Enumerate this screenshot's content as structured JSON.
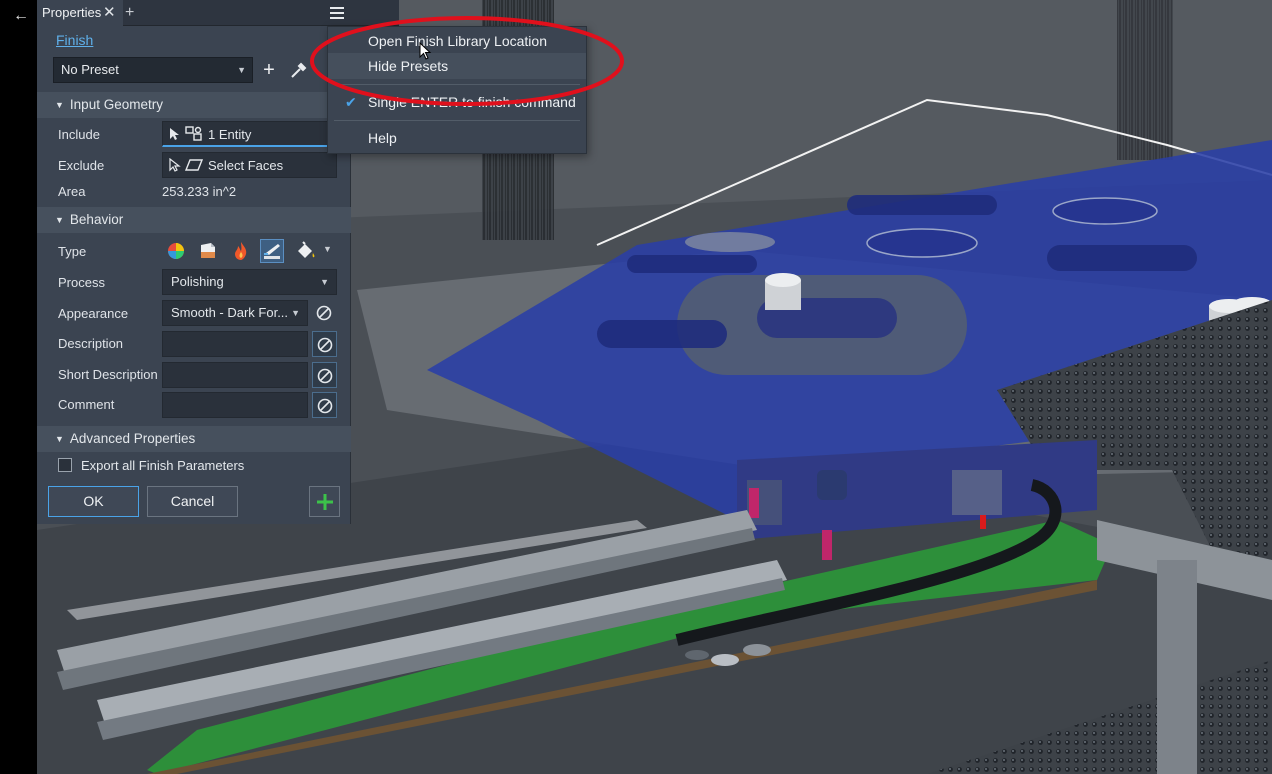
{
  "nav": {
    "back_icon": "arrow-left-icon"
  },
  "panel": {
    "tab_title": "Properties",
    "tab_close": "✕",
    "tab_add": "+",
    "finish_link": "Finish",
    "preset": {
      "value": "No Preset",
      "add": "+"
    },
    "sections": {
      "input_geometry": "Input Geometry",
      "behavior": "Behavior",
      "advanced": "Advanced Properties"
    },
    "include": {
      "label": "Include",
      "value": "1 Entity"
    },
    "exclude": {
      "label": "Exclude",
      "value": "Select Faces"
    },
    "area": {
      "label": "Area",
      "value": "253.233 in^2"
    },
    "type": {
      "label": "Type",
      "options": [
        "appearance-icon",
        "material-coating-icon",
        "heat-treatment-icon",
        "surface-finish-icon",
        "paint-icon"
      ],
      "selected_index": 3
    },
    "process": {
      "label": "Process",
      "value": "Polishing"
    },
    "appearance": {
      "label": "Appearance",
      "value": "Smooth - Dark For..."
    },
    "description": {
      "label": "Description",
      "value": ""
    },
    "short_description": {
      "label": "Short Description",
      "value": ""
    },
    "comment": {
      "label": "Comment",
      "value": ""
    },
    "export_all": {
      "label": "Export all Finish Parameters",
      "checked": false
    },
    "buttons": {
      "ok": "OK",
      "cancel": "Cancel",
      "apply": "+"
    }
  },
  "menu": {
    "items": [
      {
        "label": "Open Finish Library Location",
        "checked": false
      },
      {
        "label": "Hide Presets",
        "checked": false
      },
      {
        "label": "Single ENTER to finish command",
        "checked": true
      },
      {
        "label": "Help",
        "checked": false
      }
    ],
    "check_glyph": "✔"
  },
  "colors": {
    "panel_bg": "#3b4451",
    "accent": "#4aa3e8",
    "link": "#5fb0ea",
    "highlight_ellipse": "#e0101c",
    "plate_blue": "#2a3fa6",
    "board_green": "#2d8f3a"
  }
}
